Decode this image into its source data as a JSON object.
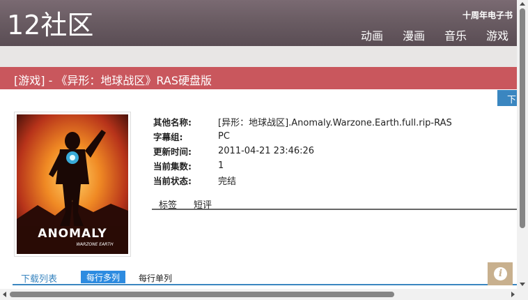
{
  "header": {
    "logo": "12社区",
    "promo": "十周年电子书",
    "nav": [
      "动画",
      "漫画",
      "音乐",
      "游戏"
    ]
  },
  "title": "[游戏] - 《异形：地球战区》RAS硬盘版",
  "download_button": "下载",
  "cover": {
    "brand_text": "ANOMALY",
    "sub_text": "WARZONE EARTH"
  },
  "info": [
    {
      "label": "其他名称:",
      "value": "[异形：地球战区].Anomaly.Warzone.Earth.full.rip-RAS"
    },
    {
      "label": "字幕组:",
      "value": "PC"
    },
    {
      "label": "更新时间:",
      "value": "2011-04-21 23:46:26"
    },
    {
      "label": "当前集数:",
      "value": "1"
    },
    {
      "label": "当前状态:",
      "value": "完结"
    }
  ],
  "tabs": [
    "标签",
    "短评"
  ],
  "download_tabs": {
    "list_label": "下载列表",
    "multi": "每行多列",
    "single": "每行单列"
  },
  "colors": {
    "header": "#6a5c63",
    "title_bar": "#c9575d",
    "accent": "#3a86c0",
    "multi_button": "#2d8be0",
    "info_button": "#c8b08e"
  }
}
